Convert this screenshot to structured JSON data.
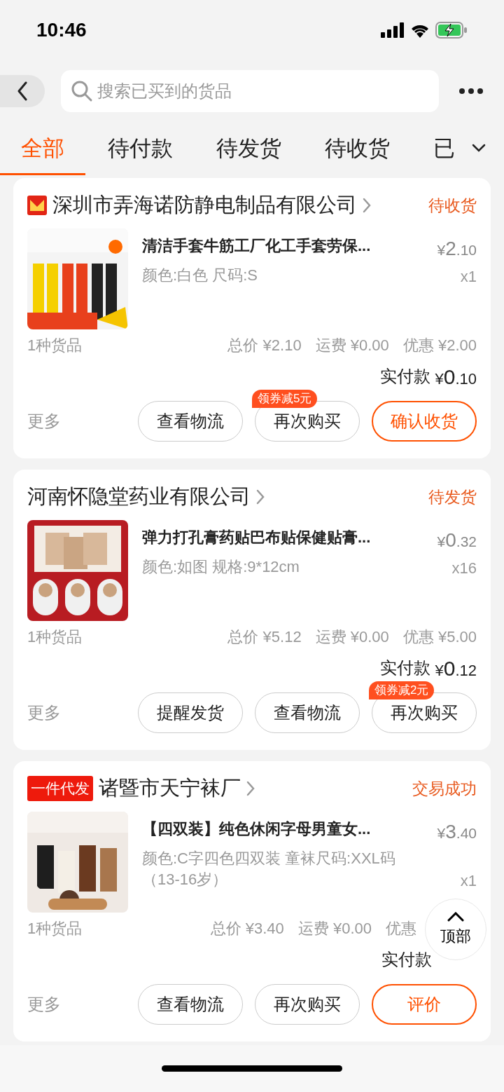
{
  "status_bar": {
    "time": "10:46"
  },
  "search": {
    "placeholder": "搜索已买到的货品"
  },
  "tabs": [
    {
      "label": "全部",
      "selected": true
    },
    {
      "label": "待付款",
      "selected": false
    },
    {
      "label": "待发货",
      "selected": false
    },
    {
      "label": "待收货",
      "selected": false
    },
    {
      "label": "已",
      "selected": false
    }
  ],
  "orders": [
    {
      "shop": "深圳市弄海诺防静电制品有限公司",
      "shop_tag": {
        "kind": "logo"
      },
      "status": "待收货",
      "item": {
        "title": "清洁手套牛筋工厂化工手套劳保...",
        "spec": "颜色:白色 尺码:S",
        "price": {
          "currency": "¥",
          "whole": "2",
          "fraction": ".10"
        },
        "qty": "x1"
      },
      "count": "1种货品",
      "total": "总价 ¥2.10",
      "shipping": "运费 ¥0.00",
      "discount": "优惠 ¥2.00",
      "paid_label": "实付款",
      "paid": {
        "currency": "¥",
        "whole": "0",
        "fraction": ".10"
      },
      "more": "更多",
      "buttons": [
        {
          "label": "查看物流",
          "primary": false
        },
        {
          "label": "再次购买",
          "primary": false,
          "coupon": "领券减5元"
        },
        {
          "label": "确认收货",
          "primary": true
        }
      ]
    },
    {
      "shop": "河南怀隐堂药业有限公司",
      "status": "待发货",
      "item": {
        "title": "弹力打孔膏药贴巴布贴保健贴膏...",
        "spec": "颜色:如图 规格:9*12cm",
        "price": {
          "currency": "¥",
          "whole": "0",
          "fraction": ".32"
        },
        "qty": "x16"
      },
      "count": "1种货品",
      "total": "总价 ¥5.12",
      "shipping": "运费 ¥0.00",
      "discount": "优惠 ¥5.00",
      "paid_label": "实付款",
      "paid": {
        "currency": "¥",
        "whole": "0",
        "fraction": ".12"
      },
      "more": "更多",
      "buttons": [
        {
          "label": "提醒发货",
          "primary": false
        },
        {
          "label": "查看物流",
          "primary": false
        },
        {
          "label": "再次购买",
          "primary": false,
          "coupon": "领券减2元"
        }
      ]
    },
    {
      "shop": "诸暨市天宁袜厂",
      "shop_tag": {
        "kind": "text",
        "text": "一件代发"
      },
      "status": "交易成功",
      "item": {
        "title": "【四双装】纯色休闲字母男童女...",
        "spec": "颜色:C字四色四双装 童袜尺码:XXL码（13-16岁）",
        "price": {
          "currency": "¥",
          "whole": "3",
          "fraction": ".40"
        },
        "qty": "x1"
      },
      "count": "1种货品",
      "total": "总价 ¥3.40",
      "shipping": "运费 ¥0.00",
      "discount": "优惠",
      "paid_label": "实付款",
      "more": "更多",
      "buttons": [
        {
          "label": "查看物流",
          "primary": false
        },
        {
          "label": "再次购买",
          "primary": false
        },
        {
          "label": "评价",
          "primary": true
        }
      ]
    }
  ],
  "back_to_top": {
    "label": "顶部"
  }
}
